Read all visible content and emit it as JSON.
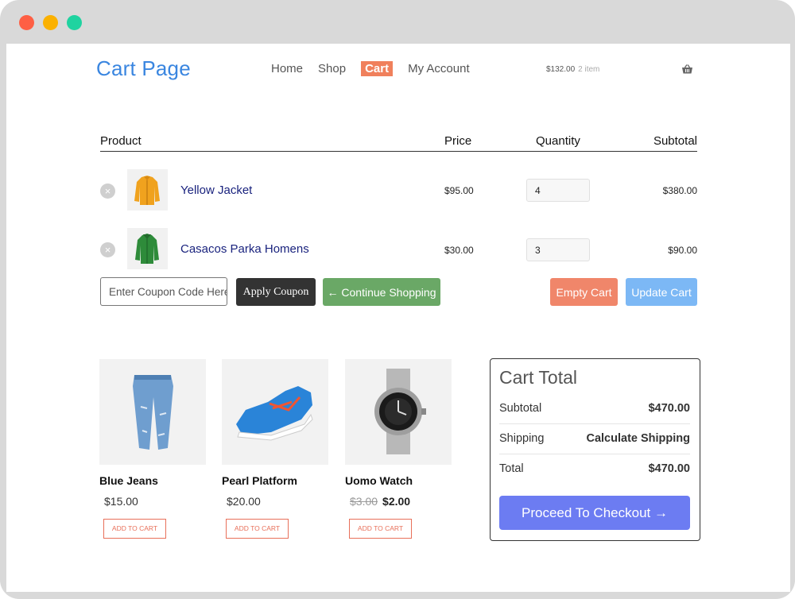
{
  "header": {
    "site_title": "Cart Page",
    "nav": [
      "Home",
      "Shop",
      "Cart",
      "My Account"
    ],
    "active_nav": "Cart",
    "cart_amount": "$132.00",
    "cart_count": "2 item"
  },
  "table": {
    "headers": {
      "product": "Product",
      "price": "Price",
      "quantity": "Quantity",
      "subtotal": "Subtotal"
    },
    "rows": [
      {
        "name": "Yellow Jacket",
        "price": "$95.00",
        "quantity": "4",
        "subtotal": "$380.00",
        "remove": "×"
      },
      {
        "name": "Casacos Parka Homens",
        "price": "$30.00",
        "quantity": "3",
        "subtotal": "$90.00",
        "remove": "×"
      }
    ]
  },
  "actions": {
    "coupon_placeholder": "Enter Coupon Code Here",
    "apply_coupon": "Apply Coupon",
    "continue_shopping": "← Continue Shopping",
    "empty_cart": "Empty Cart",
    "update_cart": "Update Cart"
  },
  "products": [
    {
      "name": "Blue Jeans",
      "price": "$15.00",
      "button": "ADD TO CART"
    },
    {
      "name": "Pearl Platform",
      "price": "$20.00",
      "button": "ADD TO CART"
    },
    {
      "name": "Uomo Watch",
      "old_price": "$3.00",
      "price": "$2.00",
      "button": "ADD TO CART"
    }
  ],
  "cart_total": {
    "title": "Cart Total",
    "subtotal_label": "Subtotal",
    "subtotal_value": "$470.00",
    "shipping_label": "Shipping",
    "shipping_value": "Calculate Shipping",
    "total_label": "Total",
    "total_value": "$470.00",
    "checkout": "Proceed To Checkout →"
  },
  "icons": {
    "window_controls": [
      "close-dot",
      "minimize-dot",
      "maximize-dot"
    ],
    "basket": "basket-icon"
  },
  "colors": {
    "brand": "#3a86e0",
    "active_nav": "#f0805c",
    "continue": "#6aa866",
    "empty": "#f0866a",
    "update": "#7cb8f5",
    "checkout": "#6c7cf2"
  }
}
